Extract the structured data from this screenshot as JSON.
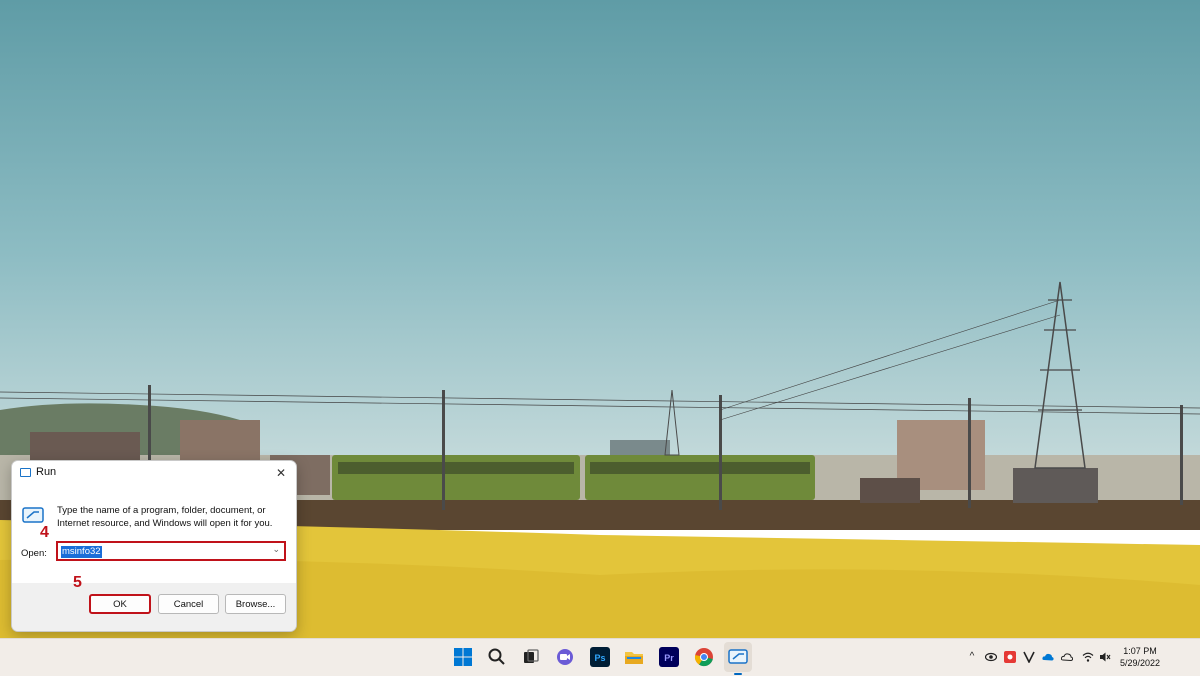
{
  "run_dialog": {
    "title": "Run",
    "description": "Type the name of a program, folder, document, or Internet resource, and Windows will open it for you.",
    "open_label": "Open:",
    "open_value": "msinfo32",
    "ok_label": "OK",
    "cancel_label": "Cancel",
    "browse_label": "Browse...",
    "close_glyph": "✕"
  },
  "annotations": {
    "step4": "4",
    "step5": "5",
    "highlight_color": "#c0121a"
  },
  "taskbar": {
    "icons": [
      "windows-start-icon",
      "search-icon",
      "task-view-icon",
      "chat-icon",
      "photoshop-icon",
      "file-explorer-icon",
      "premiere-icon",
      "chrome-icon",
      "run-app-icon"
    ],
    "photoshop_text": "Ps",
    "premiere_text": "Pr",
    "time": "1:07 PM",
    "date": "5/29/2022",
    "tray_chevron": "^"
  },
  "colors": {
    "accent": "#0067c0",
    "sky": "#6fa7b0",
    "field": "#e3c53a"
  }
}
